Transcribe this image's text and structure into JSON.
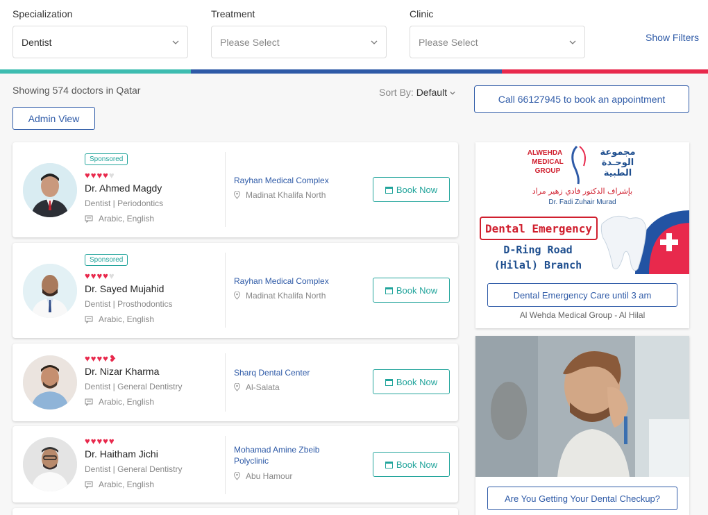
{
  "filters": {
    "specialization": {
      "label": "Specialization",
      "value": "Dentist"
    },
    "treatment": {
      "label": "Treatment",
      "placeholder": "Please Select"
    },
    "clinic": {
      "label": "Clinic",
      "placeholder": "Please Select"
    },
    "show_filters": "Show Filters"
  },
  "colors": {
    "teal": "#3dbcb0",
    "blue": "#2e5aa7",
    "red": "#e8294c"
  },
  "results": {
    "showing_text": "Showing 574 doctors in Qatar",
    "sort_label": "Sort By:",
    "sort_value": "Default",
    "call_button": "Call 66127945 to book an appointment",
    "admin_button": "Admin View"
  },
  "doctors": [
    {
      "sponsored": "Sponsored",
      "rating": 4,
      "name": "Dr. Ahmed Magdy",
      "specialty": "Dentist | Periodontics",
      "languages": "Arabic, English",
      "clinic": "Rayhan Medical Complex",
      "location": "Madinat Khalifa North",
      "book": "Book Now"
    },
    {
      "sponsored": "Sponsored",
      "rating": 4,
      "name": "Dr. Sayed Mujahid",
      "specialty": "Dentist | Prosthodontics",
      "languages": "Arabic, English",
      "clinic": "Rayhan Medical Complex",
      "location": "Madinat Khalifa North",
      "book": "Book Now"
    },
    {
      "rating": 4.5,
      "name": "Dr. Nizar Kharma",
      "specialty": "Dentist | General Dentistry",
      "languages": "Arabic, English",
      "clinic": "Sharq Dental Center",
      "location": "Al-Salata",
      "book": "Book Now"
    },
    {
      "rating": 5,
      "name": "Dr. Haitham Jichi",
      "specialty": "Dentist | General Dentistry",
      "languages": "Arabic, English",
      "clinic": "Mohamad Amine Zbeib Polyclinic",
      "location": "Abu Hamour",
      "book": "Book Now"
    }
  ],
  "ads": [
    {
      "logo_en": [
        "ALWEHDA",
        "MEDICAL",
        "GROUP"
      ],
      "logo_ar": [
        "مجموعة",
        "الوحـدة",
        "الطبية"
      ],
      "supervision_ar": "بإشراف الدكتور فادي زهير مراد",
      "supervision_en": "Dr. Fadi Zuhair Murad",
      "banner": "Dental Emergency",
      "branch_line1": "D-Ring Road",
      "branch_line2": "(Hilal) Branch",
      "button": "Dental Emergency Care until 3 am",
      "caption": "Al Wehda Medical Group - Al Hilal"
    },
    {
      "button": "Are You Getting Your Dental Checkup?"
    }
  ]
}
